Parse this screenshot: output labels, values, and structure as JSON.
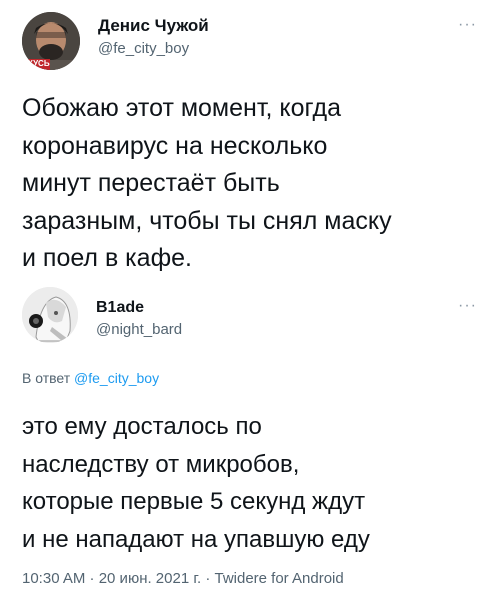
{
  "tweet1": {
    "display_name": "Денис Чужой",
    "handle": "@fe_city_boy",
    "avatar_badge": "КУСЬ",
    "more": "···",
    "lines": [
      "Обожаю этот момент, когда",
      "коронавирус на несколько",
      "минут перестаёт быть",
      "заразным, чтобы ты снял маску",
      "и поел в кафе."
    ]
  },
  "tweet2": {
    "display_name": "B1ade",
    "handle": "@night_bard",
    "more": "···",
    "reply_prefix": "В ответ",
    "reply_handle": "@fe_city_boy",
    "lines": [
      "это ему досталось по",
      "наследству от микробов,",
      "которые первые 5 секунд ждут",
      "и не нападают на упавшую еду"
    ],
    "meta": "10:30 AM · 20 июн. 2021 г. · Twidere for Android"
  }
}
